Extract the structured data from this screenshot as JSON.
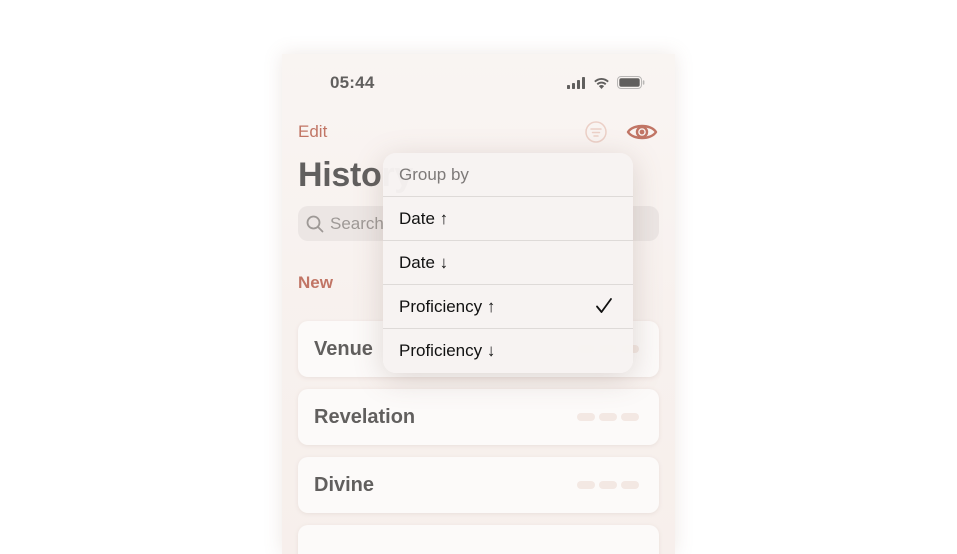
{
  "status_bar": {
    "time": "05:44"
  },
  "nav": {
    "edit_label": "Edit"
  },
  "page": {
    "title": "History"
  },
  "search": {
    "placeholder": "Search"
  },
  "section": {
    "title": "New"
  },
  "cards": [
    {
      "word": "Venue"
    },
    {
      "word": "Revelation"
    },
    {
      "word": "Divine"
    },
    {
      "word": ""
    }
  ],
  "menu": {
    "header": "Group by",
    "items": [
      {
        "label": "Date ↑",
        "checked": false
      },
      {
        "label": "Date ↓",
        "checked": false
      },
      {
        "label": "Proficiency ↑",
        "checked": true
      },
      {
        "label": "Proficiency ↓",
        "checked": false
      }
    ]
  },
  "colors": {
    "accent": "#a5341c",
    "pill": "#f1e3de"
  },
  "icons": [
    "cellular-signal-icon",
    "wifi-icon",
    "battery-icon",
    "group-by-icon",
    "eye-icon",
    "search-icon",
    "checkmark-icon"
  ]
}
